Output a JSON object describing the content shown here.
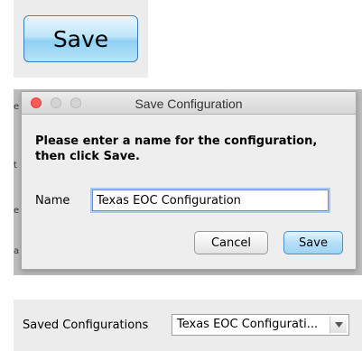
{
  "top_button": {
    "label": "Save"
  },
  "dialog": {
    "title": "Save Configuration",
    "prompt_line1": "Please enter a name for the configuration,",
    "prompt_line2": "then click Save.",
    "name_label": "Name",
    "name_value": "Texas EOC Configuration",
    "cancel_label": "Cancel",
    "save_label": "Save"
  },
  "saved_configurations": {
    "label": "Saved Configurations",
    "selected_value": "Texas EOC Configurati..."
  },
  "background_fragments": [
    "e",
    "t",
    "e",
    "a"
  ],
  "colors": {
    "close_button": "#fc5b57",
    "save_button_accent": "#8fd0f3",
    "input_focus": "#6a97d6"
  },
  "icons": {
    "close": "window-close-icon",
    "minimize": "window-minimize-icon",
    "maximize": "window-maximize-icon",
    "dropdown": "chevron-down-icon"
  }
}
